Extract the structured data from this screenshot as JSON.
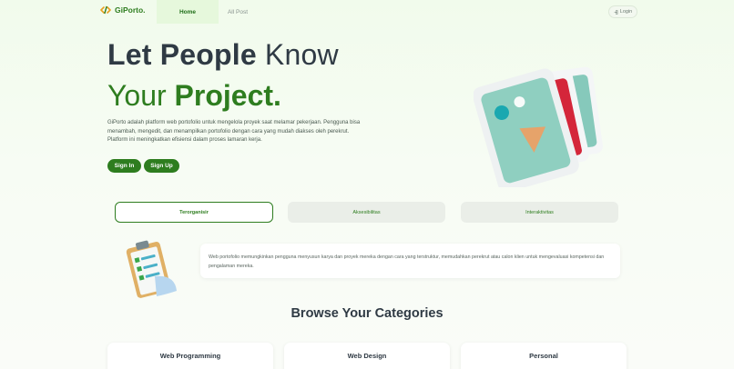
{
  "nav": {
    "brand": "GiPorto.",
    "brand_icon": "code-logo-icon",
    "tabs": [
      {
        "label": "Home",
        "active": true
      },
      {
        "label": "All Post",
        "active": false
      }
    ],
    "login_label": "Login",
    "login_icon": "login-icon"
  },
  "hero": {
    "title_line1_bold": "Let People",
    "title_line1_regular": "Know",
    "title_line2_regular": "Your",
    "title_line2_bold": "Project.",
    "description": "GiPorto adalah platform web portofolio untuk mengelola proyek saat melamar pekerjaan. Pengguna bisa menambah, mengedit, dan menampilkan portofolio dengan cara yang mudah diakses oleh perekrut. Platform ini meningkatkan efisiensi dalam proses lamaran kerja.",
    "signin_label": "Sign In",
    "signup_label": "Sign Up",
    "illustration": "image-gallery-3d-icon"
  },
  "features": {
    "tabs": [
      {
        "label": "Terorganisir",
        "active": true
      },
      {
        "label": "Aksesibilitas",
        "active": false
      },
      {
        "label": "Interaktivitas",
        "active": false
      }
    ],
    "illustration": "clipboard-checklist-icon",
    "description": "Web portofolio memungkinkan pengguna menyusun karya dan proyek mereka dengan cara yang terstruktur, memudahkan perekrut atau calon klien untuk mengevaluasi kompetensi dan pengalaman mereka."
  },
  "categories": {
    "title": "Browse Your Categories",
    "items": [
      {
        "label": "Web Programming"
      },
      {
        "label": "Web Design"
      },
      {
        "label": "Personal"
      }
    ]
  },
  "colors": {
    "brand_green": "#2e7d1f",
    "heading_dark": "#2f3a44",
    "background": "#f1fbec"
  }
}
